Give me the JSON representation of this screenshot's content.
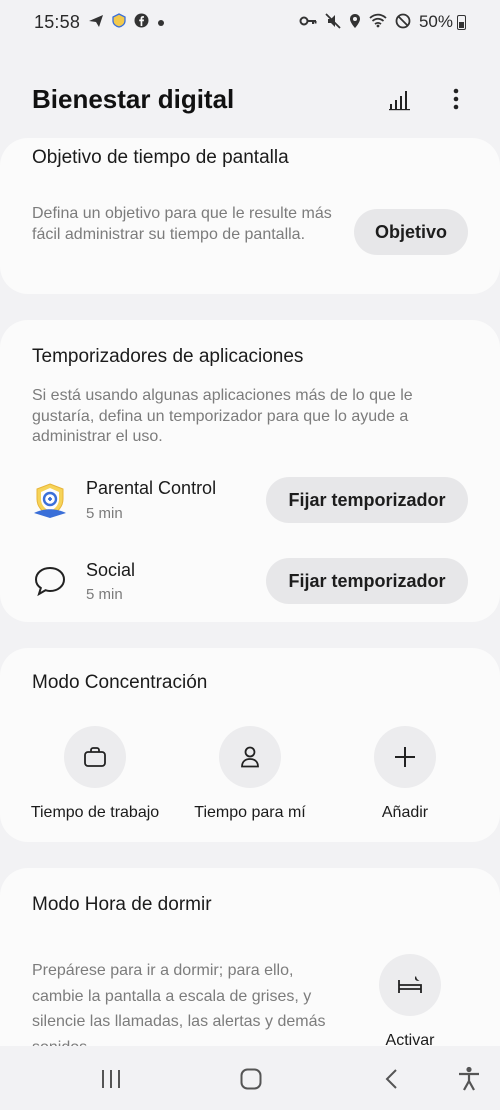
{
  "status_bar": {
    "time": "15:58",
    "battery": "50%",
    "left_icons": [
      "send-icon",
      "parental-control-icon",
      "facebook-icon",
      "dot-icon"
    ],
    "right_icons": [
      "vpn-key-icon",
      "mute-icon",
      "location-icon",
      "wifi-icon",
      "do-not-disturb-icon",
      "battery-icon"
    ]
  },
  "header": {
    "title": "Bienestar digital"
  },
  "screen_time": {
    "title": "Objetivo de tiempo de pantalla",
    "description": "Defina un objetivo para que le resulte más fácil administrar su tiempo de pantalla.",
    "button_label": "Objetivo"
  },
  "app_timers": {
    "title": "Temporizadores de aplicaciones",
    "description": "Si está usando algunas aplicaciones más de lo que le gustaría, defina un temporizador para que lo ayude a administrar el uso.",
    "apps": [
      {
        "name": "Parental Control",
        "time": "5 min",
        "button_label": "Fijar temporizador",
        "icon": "parental-control-icon"
      },
      {
        "name": "Social",
        "time": "5 min",
        "button_label": "Fijar temporizador",
        "icon": "chat-bubble-icon"
      }
    ]
  },
  "focus_mode": {
    "title": "Modo Concentración",
    "modes": [
      {
        "label": "Tiempo de trabajo",
        "icon": "briefcase-icon"
      },
      {
        "label": "Tiempo para mí",
        "icon": "person-icon"
      },
      {
        "label": "Añadir",
        "icon": "plus-icon"
      }
    ]
  },
  "bedtime": {
    "title": "Modo Hora de dormir",
    "description": "Prepárese para ir a dormir; para ello, cambie la pantalla a escala de grises, y silencie las llamadas, las alertas y demás sonidos.",
    "button_label": "Activar",
    "icon": "bed-icon"
  },
  "nav_bar": {
    "icons": [
      "recents-icon",
      "home-icon",
      "back-icon",
      "accessibility-icon"
    ]
  }
}
